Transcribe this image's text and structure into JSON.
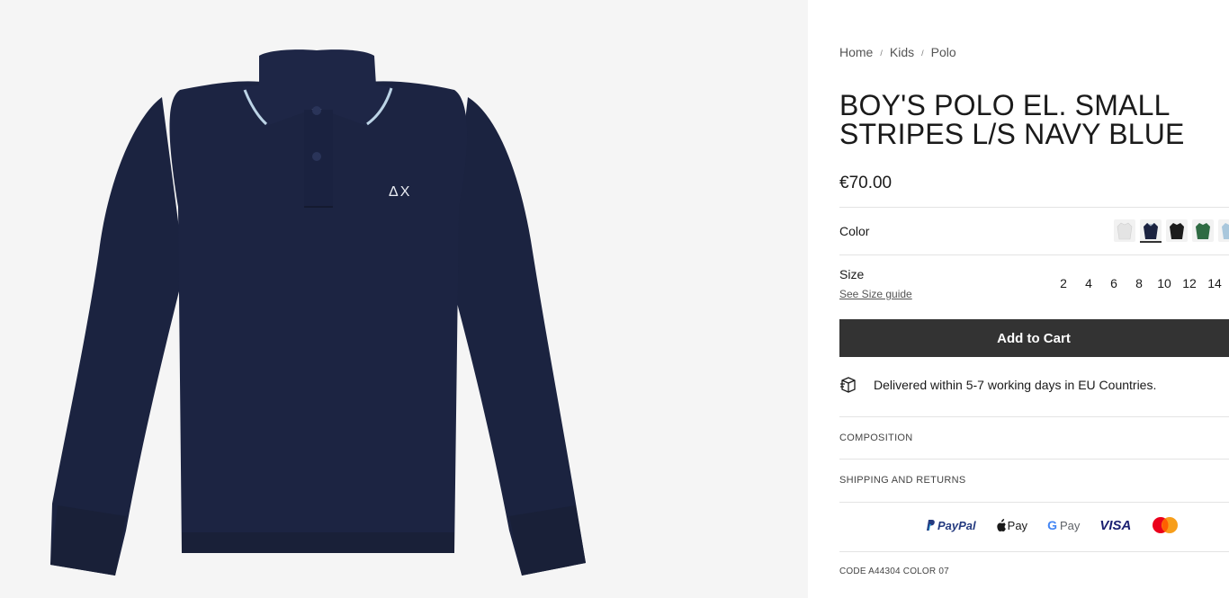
{
  "product_image": {
    "logo_text": "ΔX",
    "bg_color": "#f5f5f5",
    "garment_color": "#1b2340"
  },
  "breadcrumb": {
    "items": [
      "Home",
      "Kids",
      "Polo"
    ],
    "separator": "/"
  },
  "product": {
    "title": "BOY'S POLO EL. SMALL STRIPES L/S NAVY BLUE",
    "price": "€70.00",
    "code": "CODE A44304 COLOR 07"
  },
  "color": {
    "label": "Color",
    "swatches": [
      {
        "icon": "polo-swatch-icon",
        "color": "#e6e6e6"
      },
      {
        "icon": "polo-swatch-icon",
        "color": "#1b2340",
        "selected": true
      },
      {
        "icon": "polo-swatch-icon",
        "color": "#1c1c1c"
      },
      {
        "icon": "polo-swatch-icon",
        "color": "#2f6b43"
      },
      {
        "icon": "polo-swatch-icon",
        "color": "#a9c7dc"
      }
    ]
  },
  "size": {
    "label": "Size",
    "guide_link": "See Size guide",
    "options": [
      "2",
      "4",
      "6",
      "8",
      "10",
      "12",
      "14"
    ]
  },
  "cart": {
    "button_label": "Add to Cart",
    "button_color": "#333333"
  },
  "delivery": {
    "icon": "box-icon",
    "text": "Delivered within 5-7 working days in EU Countries."
  },
  "accordions": {
    "composition": "COMPOSITION",
    "shipping": "SHIPPING AND RETURNS"
  },
  "payments": {
    "paypal": "PayPal",
    "applepay": "Pay",
    "googlepay": "Pay",
    "visa": "VISA"
  }
}
